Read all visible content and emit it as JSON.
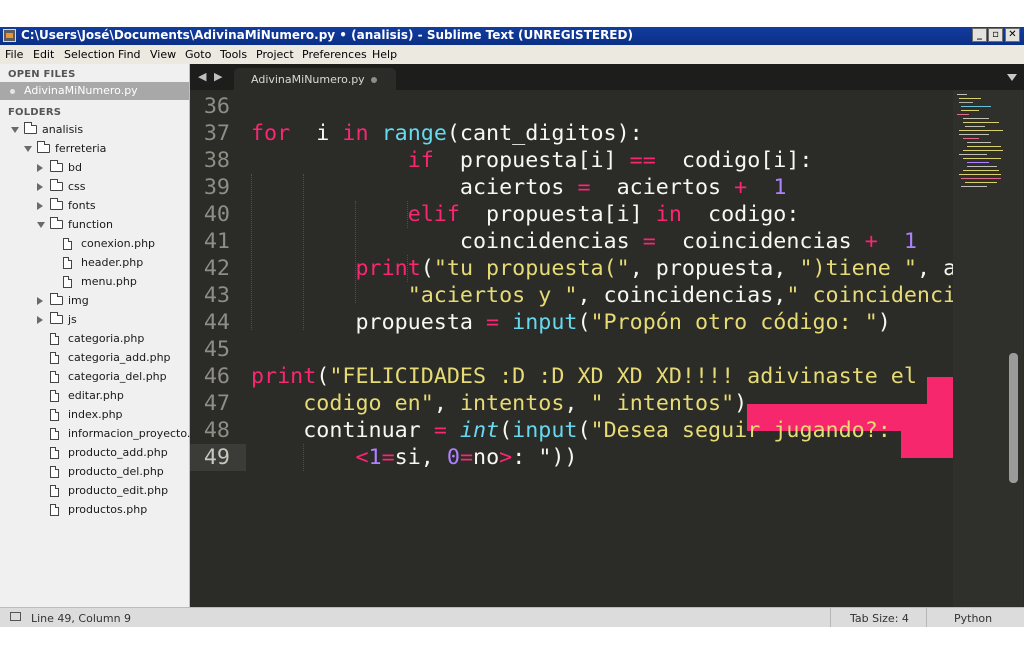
{
  "window": {
    "title": "C:\\Users\\José\\Documents\\AdivinaMiNumero.py • (analisis) - Sublime Text (UNREGISTERED)",
    "minimize": "_",
    "maximize": "▫",
    "close": "✕"
  },
  "menu": [
    "File",
    "Edit",
    "Selection",
    "Find",
    "View",
    "Goto",
    "Tools",
    "Project",
    "Preferences",
    "Help"
  ],
  "sidebar": {
    "open_files_header": "OPEN FILES",
    "open_file": "AdivinaMiNumero.py",
    "folders_header": "FOLDERS",
    "tree": [
      {
        "label": "analisis",
        "kind": "folder",
        "state": "open"
      },
      {
        "label": "ferreteria",
        "kind": "folder",
        "state": "open"
      },
      {
        "label": "bd",
        "kind": "folder",
        "state": "closed"
      },
      {
        "label": "css",
        "kind": "folder",
        "state": "closed"
      },
      {
        "label": "fonts",
        "kind": "folder",
        "state": "closed"
      },
      {
        "label": "function",
        "kind": "folder",
        "state": "open"
      },
      {
        "label": "conexion.php",
        "kind": "file"
      },
      {
        "label": "header.php",
        "kind": "file"
      },
      {
        "label": "menu.php",
        "kind": "file"
      },
      {
        "label": "img",
        "kind": "folder",
        "state": "closed"
      },
      {
        "label": "js",
        "kind": "folder",
        "state": "closed"
      },
      {
        "label": "categoria.php",
        "kind": "file"
      },
      {
        "label": "categoria_add.php",
        "kind": "file"
      },
      {
        "label": "categoria_del.php",
        "kind": "file"
      },
      {
        "label": "editar.php",
        "kind": "file"
      },
      {
        "label": "index.php",
        "kind": "file"
      },
      {
        "label": "informacion_proyecto.p",
        "kind": "file"
      },
      {
        "label": "producto_add.php",
        "kind": "file"
      },
      {
        "label": "producto_del.php",
        "kind": "file"
      },
      {
        "label": "producto_edit.php",
        "kind": "file"
      },
      {
        "label": "productos.php",
        "kind": "file"
      }
    ]
  },
  "tabs": {
    "back": "◀",
    "forward": "▶",
    "active_tab": "AdivinaMiNumero.py",
    "active_tab_modified": true
  },
  "editor": {
    "current_line": 49,
    "lines": [
      {
        "n": "36",
        "tokens": []
      },
      {
        "n": "37",
        "tokens": [
          [
            "kw",
            "for"
          ],
          [
            "",
            "  i "
          ],
          [
            "kw",
            "in"
          ],
          [
            "",
            ""
          ],
          [
            "fn",
            " range"
          ],
          [
            "",
            "(cant_digitos):"
          ]
        ]
      },
      {
        "n": "38",
        "tokens": [
          [
            "",
            "            "
          ],
          [
            "kw",
            "if"
          ],
          [
            "",
            ""
          ],
          [
            "",
            ""
          ],
          [
            "",
            ""
          ],
          [
            "",
            ""
          ],
          [
            "",
            ""
          ],
          [
            "",
            ""
          ],
          [
            "",
            ""
          ],
          [
            "",
            "  propuesta[i] "
          ],
          [
            "kw",
            "=="
          ],
          [
            "",
            "  codigo[i]:"
          ]
        ]
      },
      {
        "n": "39",
        "tokens": [
          [
            "",
            "                aciertos "
          ],
          [
            "kw",
            "="
          ],
          [
            "",
            "  aciertos "
          ],
          [
            "kw",
            "+"
          ],
          [
            "",
            ""
          ],
          [
            "num",
            "  1"
          ]
        ]
      },
      {
        "n": "40",
        "tokens": [
          [
            "",
            "            "
          ],
          [
            "kw",
            "elif"
          ],
          [
            "",
            "  propuesta[i] "
          ],
          [
            "kw",
            "in"
          ],
          [
            "",
            "  codigo:"
          ]
        ]
      },
      {
        "n": "41",
        "tokens": [
          [
            "",
            "                coincidencias "
          ],
          [
            "kw",
            "="
          ],
          [
            "",
            "  coincidencias "
          ],
          [
            "kw",
            "+"
          ],
          [
            "num",
            "  1"
          ]
        ]
      },
      {
        "n": "42",
        "tokens": [
          [
            "",
            "        "
          ],
          [
            "kw",
            "print"
          ],
          [
            "",
            "("
          ],
          [
            "str",
            "\"tu propuesta(\""
          ],
          [
            "",
            ", propuesta, "
          ],
          [
            "str",
            "\")tiene \""
          ],
          [
            "",
            ", a"
          ]
        ]
      },
      {
        "n": "43",
        "tokens": [
          [
            "",
            "            "
          ],
          [
            "str",
            "\"aciertos y \""
          ],
          [
            "",
            ", coincidencias,"
          ],
          [
            "str",
            "\" coincidenci"
          ]
        ]
      },
      {
        "n": "44",
        "tokens": [
          [
            "",
            "        propuesta "
          ],
          [
            "kw",
            "="
          ],
          [
            "fn",
            " input"
          ],
          [
            "",
            "("
          ],
          [
            "str",
            "\"Propón otro código: \""
          ],
          [
            "",
            ")"
          ]
        ]
      },
      {
        "n": "45",
        "tokens": []
      },
      {
        "n": "46",
        "tokens": [
          [
            "kw",
            "print"
          ],
          [
            "",
            "("
          ],
          [
            "str",
            "\"FELICIDADES :D :D XD XD XD!!!! adivinaste el"
          ]
        ]
      },
      {
        "n": "47",
        "tokens": [
          [
            "str",
            "    codigo en\""
          ],
          [
            "",
            ", "
          ],
          [
            "str",
            "intentos"
          ],
          [
            "",
            ", "
          ],
          [
            "str",
            "\" intentos\""
          ],
          [
            "",
            ")"
          ]
        ]
      },
      {
        "n": "48",
        "tokens": [
          [
            "",
            "    continuar "
          ],
          [
            "kw",
            "="
          ],
          [
            "",
            ""
          ],
          [
            "it",
            " int"
          ],
          [
            "",
            "("
          ],
          [
            "fn",
            "input"
          ],
          [
            "",
            "("
          ],
          [
            "str",
            "\"Desea seguir jugando?: "
          ]
        ]
      },
      {
        "n": "49",
        "tokens": [
          [
            "",
            "        "
          ],
          [
            "kw",
            "<"
          ],
          [
            "num",
            "1"
          ],
          [
            "kw",
            "="
          ],
          [
            "",
            "si, "
          ],
          [
            "num",
            "0"
          ],
          [
            "kw",
            "="
          ],
          [
            "",
            "no"
          ],
          [
            "kw",
            ">"
          ],
          [
            "",
            ": \"))"
          ]
        ]
      }
    ]
  },
  "status": {
    "position": "Line 49, Column 9",
    "tab_size": "Tab Size: 4",
    "syntax": "Python"
  },
  "colors": {
    "keyword": "#f92672",
    "function": "#66d9ef",
    "string": "#e6db74",
    "number": "#ae81ff",
    "selection": "#f6276d",
    "background": "#2b2b28"
  }
}
